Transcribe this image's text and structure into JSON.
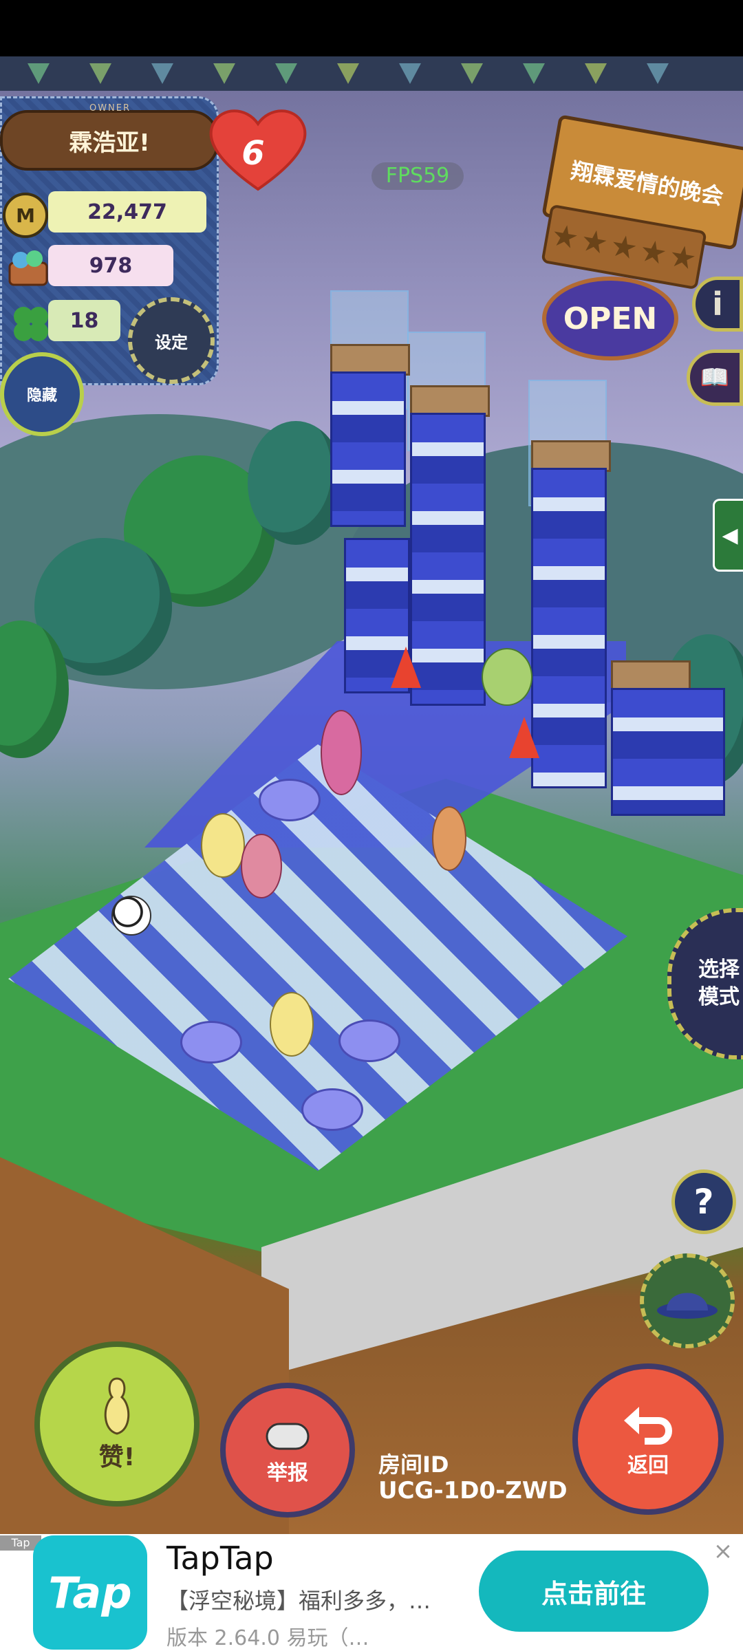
{
  "hud": {
    "owner_caption": "OWNER",
    "owner_name": "霖浩亚!",
    "heart_count": "6",
    "coins": "22,477",
    "gifts": "978",
    "clovers": "18",
    "settings_label": "设定",
    "hide_label": "隐藏",
    "fps": "FPS59",
    "coin_symbol": "M"
  },
  "shop": {
    "name": "翔霖爱情的晚会",
    "stars_filled": 0,
    "stars_total": 5,
    "open_label": "OPEN"
  },
  "side_buttons": {
    "info_label": "i",
    "mode_label_line1": "选择",
    "mode_label_line2": "模式",
    "help_label": "?"
  },
  "bottom": {
    "like_label": "赞!",
    "report_label": "举报",
    "back_label": "返回",
    "room_id_label": "房间ID",
    "room_id_value": "UCG-1D0-ZWD"
  },
  "ad": {
    "tag": "Tap",
    "logo_text": "Tap",
    "title": "TapTap",
    "description": "【浮空秘境】福利多多，…",
    "version": "版本 2.64.0  易玩（…",
    "cta": "点击前往",
    "close": "×"
  },
  "colors": {
    "accent_teal": "#14b8bd",
    "like_green": "#b6d64a",
    "report_red": "#e0524a",
    "back_orange": "#ec5840",
    "fps_green": "#5fdc5f"
  }
}
